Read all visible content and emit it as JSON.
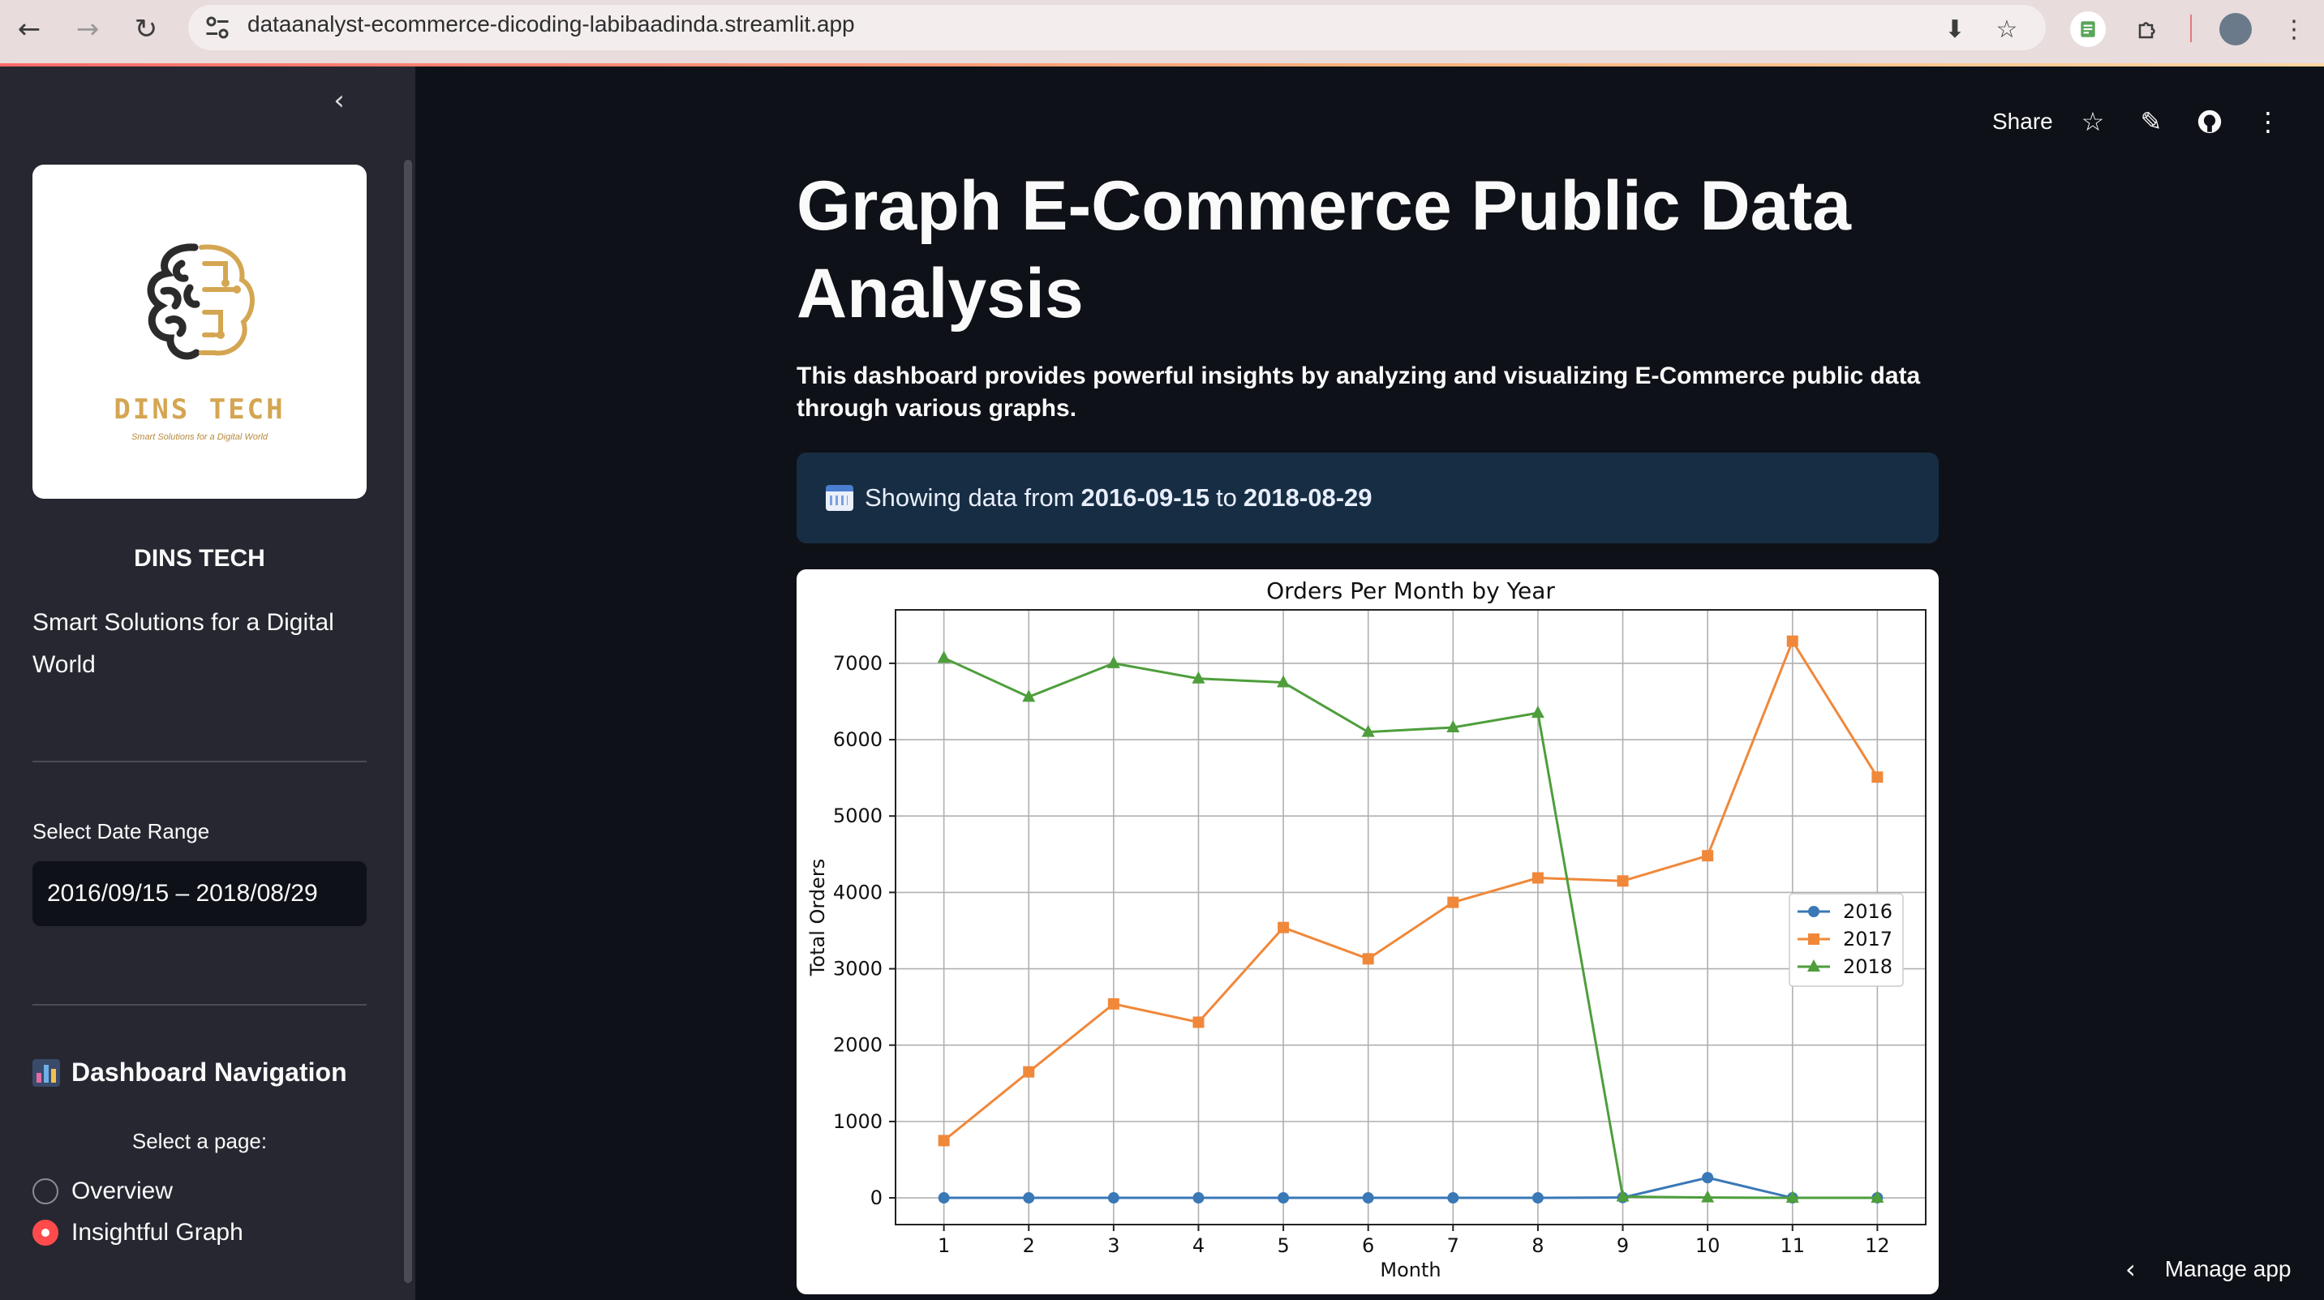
{
  "browser": {
    "url": "dataanalyst-ecommerce-dicoding-labibaadinda.streamlit.app",
    "icons": [
      "back-icon",
      "forward-icon",
      "reload-icon",
      "site-settings-icon",
      "install-app-icon",
      "bookmark-star-icon",
      "extension-icon",
      "puzzle-icon",
      "profile-avatar",
      "browser-menu-icon"
    ]
  },
  "sidebar": {
    "brand": "DINS TECH",
    "tagline": "Smart Solutions for a Digital World",
    "logo_text": "DINS TECH",
    "logo_tagline": "Smart Solutions for a Digital World",
    "date_label": "Select Date Range",
    "date_value": "2016/09/15 – 2018/08/29",
    "nav_heading": "Dashboard Navigation",
    "select_label": "Select a page:",
    "pages": [
      {
        "label": "Overview",
        "selected": false
      },
      {
        "label": "Insightful Graph",
        "selected": true
      }
    ]
  },
  "toolbar": {
    "share": "Share"
  },
  "main": {
    "title": "Graph E-Commerce Public Data Analysis",
    "description": "This dashboard provides powerful insights by analyzing and visualizing E-Commerce public data through various graphs.",
    "info_prefix": "Showing data from",
    "info_start": "2016-09-15",
    "info_mid": "to",
    "info_end": "2018-08-29",
    "manage_app": "Manage app"
  },
  "colors": {
    "accent": "#ff4b4b",
    "series_2016": "#3a78b6",
    "series_2017": "#f0883a",
    "series_2018": "#4e9e3c"
  },
  "chart_data": {
    "type": "line",
    "title": "Orders Per Month by Year",
    "xlabel": "Month",
    "ylabel": "Total Orders",
    "x": [
      1,
      2,
      3,
      4,
      5,
      6,
      7,
      8,
      9,
      10,
      11,
      12
    ],
    "ylim": [
      -350,
      7700
    ],
    "yticks": [
      0,
      1000,
      2000,
      3000,
      4000,
      5000,
      6000,
      7000
    ],
    "grid": true,
    "legend": "right",
    "series": [
      {
        "name": "2016",
        "marker": "circle",
        "values": [
          0,
          0,
          0,
          0,
          0,
          0,
          0,
          0,
          4,
          264,
          0,
          1
        ]
      },
      {
        "name": "2017",
        "marker": "square",
        "values": [
          750,
          1650,
          2540,
          2300,
          3540,
          3130,
          3870,
          4190,
          4150,
          4480,
          7290,
          5510
        ]
      },
      {
        "name": "2018",
        "marker": "triangle",
        "values": [
          7070,
          6560,
          7000,
          6800,
          6750,
          6100,
          6160,
          6350,
          16,
          4,
          0,
          0
        ]
      }
    ]
  }
}
